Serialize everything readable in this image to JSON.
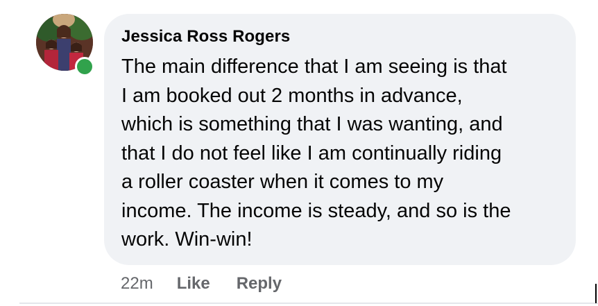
{
  "comment": {
    "author": "Jessica Ross Rogers",
    "avatar_icon": "profile-photo",
    "online_status_color": "#31a24c",
    "lines": [
      "The main difference that I am seeing is that",
      "I am booked out 2 months in advance,",
      "which is something that I was wanting, and",
      "that I do not feel like I am continually riding",
      "a roller coaster when it comes to my",
      "income. The income is steady, and so is the",
      "work. Win-win!"
    ],
    "timestamp": "22m",
    "like_label": "Like",
    "reply_label": "Reply"
  },
  "colors": {
    "bubble": "#f0f2f5",
    "text": "#050505",
    "secondary": "#65676b"
  }
}
